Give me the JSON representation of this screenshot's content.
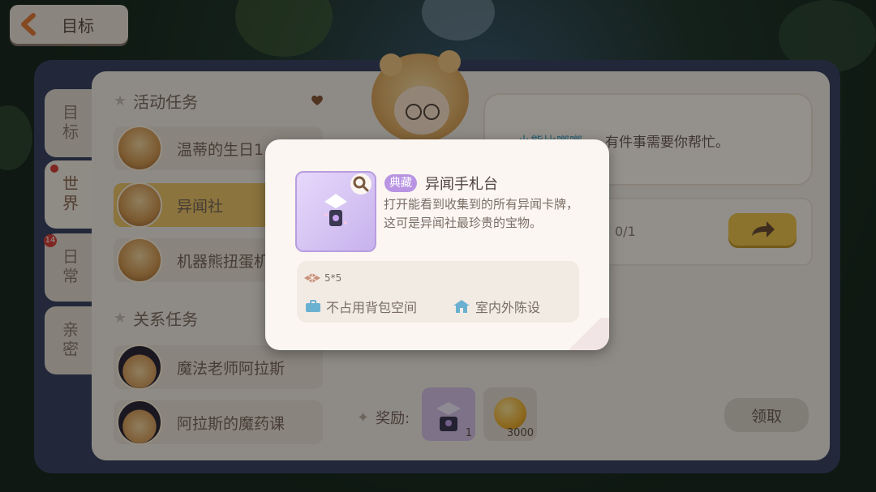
{
  "header": {
    "back_label": "目标"
  },
  "side_tabs": [
    {
      "label": "目标",
      "active": false
    },
    {
      "label": "世界",
      "active": true,
      "dot": true
    },
    {
      "label": "日常",
      "active": false,
      "badge": "14"
    },
    {
      "label": "亲密",
      "active": false
    }
  ],
  "sections": {
    "activity": {
      "title": "活动任务",
      "items": [
        {
          "label": "温蒂的生日1",
          "avatar": "bear-girl-avatar",
          "active": false
        },
        {
          "label": "异闻社",
          "avatar": "blonde-girl-avatar",
          "active": true
        },
        {
          "label": "机器熊扭蛋机",
          "avatar": "robot-bear-avatar",
          "active": false
        }
      ]
    },
    "relation": {
      "title": "关系任务",
      "items": [
        {
          "label": "魔法老师阿拉斯",
          "avatar": "witch-avatar"
        },
        {
          "label": "阿拉斯的魔药课",
          "avatar": "witch-avatar"
        }
      ]
    }
  },
  "detail": {
    "speaker": "小熊比啷啷",
    "dialog": "有件事需要你帮忙。",
    "progress": "0/1",
    "reward_label": "奖励:",
    "rewards": [
      {
        "icon": "notebook-stand-icon",
        "count": "1"
      },
      {
        "icon": "gold-coin-icon",
        "count": "3000"
      }
    ],
    "claim_label": "领取"
  },
  "popup": {
    "tag": "典藏",
    "title": "异闻手札台",
    "description": "打开能看到收集到的所有异闻卡牌，这可是异闻社最珍贵的宝物。",
    "size": "5*5",
    "features": [
      "不占用背包空间",
      "室内外陈设"
    ]
  },
  "colors": {
    "accent_yellow": "#efc96a",
    "tag_purple": "#b894e3",
    "panel_cream": "#f5efe7"
  }
}
